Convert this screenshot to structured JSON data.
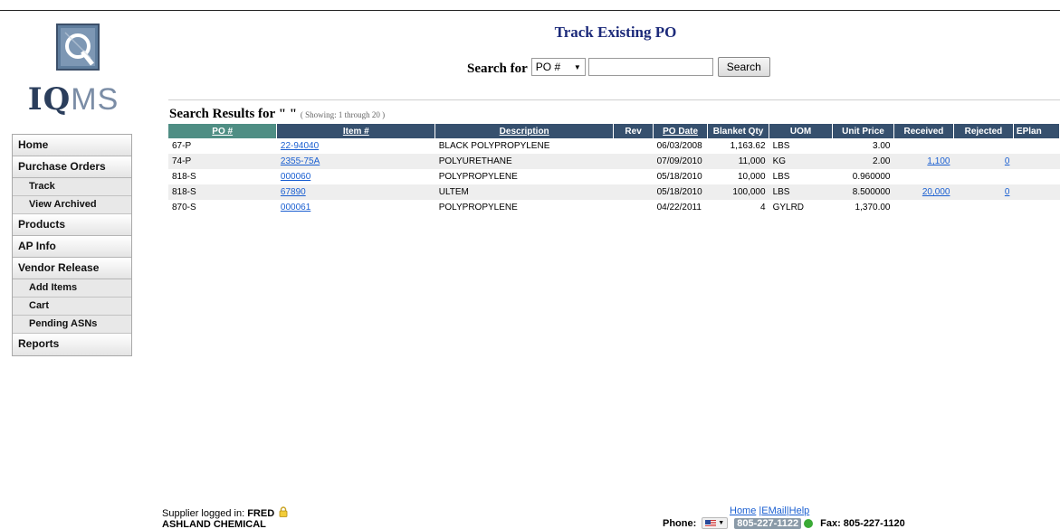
{
  "brand": {
    "logo_text_a": "IQ",
    "logo_text_b": "MS"
  },
  "page": {
    "title": "Track Existing PO"
  },
  "search": {
    "label": "Search for",
    "field_option": "PO #",
    "query_value": "",
    "button_label": "Search"
  },
  "sidebar": {
    "home": "Home",
    "purchase_orders": "Purchase Orders",
    "track": "Track",
    "view_archived": "View Archived",
    "products": "Products",
    "ap_info": "AP Info",
    "vendor_release": "Vendor Release",
    "add_items": "Add Items",
    "cart": "Cart",
    "pending_asns": "Pending ASNs",
    "reports": "Reports"
  },
  "results": {
    "heading": "Search Results for \" \"",
    "showing": "( Showing: 1 through 20 )",
    "columns": [
      "PO #",
      "Item #",
      "Description",
      "Rev",
      "PO Date",
      "Blanket Qty",
      "UOM",
      "Unit Price",
      "Received",
      "Rejected",
      "EPlan"
    ],
    "rows": [
      {
        "po": "67-P",
        "item": "22-94040",
        "desc": "BLACK POLYPROPYLENE",
        "rev": "",
        "date": "06/03/2008",
        "qty": "1,163.62",
        "uom": "LBS",
        "price": "3.00",
        "received": "",
        "rejected": ""
      },
      {
        "po": "74-P",
        "item": "2355-75A",
        "desc": "POLYURETHANE",
        "rev": "",
        "date": "07/09/2010",
        "qty": "11,000",
        "uom": "KG",
        "price": "2.00",
        "received": "1,100",
        "rejected": "0"
      },
      {
        "po": "818-S",
        "item": "000060",
        "desc": "POLYPROPYLENE",
        "rev": "",
        "date": "05/18/2010",
        "qty": "10,000",
        "uom": "LBS",
        "price": "0.960000",
        "received": "",
        "rejected": ""
      },
      {
        "po": "818-S",
        "item": "67890",
        "desc": "ULTEM",
        "rev": "",
        "date": "05/18/2010",
        "qty": "100,000",
        "uom": "LBS",
        "price": "8.500000",
        "received": "20,000",
        "rejected": "0"
      },
      {
        "po": "870-S",
        "item": "000061",
        "desc": "POLYPROPYLENE",
        "rev": "",
        "date": "04/22/2011",
        "qty": "4",
        "uom": "GYLRD",
        "price": "1,370.00",
        "received": "",
        "rejected": ""
      }
    ]
  },
  "footer": {
    "logged_in_label": "Supplier logged in:",
    "user": "FRED",
    "company": "ASHLAND CHEMICAL",
    "link_home": "Home",
    "link_email": "EMail",
    "link_help": "Help",
    "sep": "|",
    "phone_label": "Phone:",
    "phone": "805-227-1122",
    "fax": "Fax: 805-227-1120"
  },
  "colors": {
    "header_bg": "#36506e",
    "sort_col_bg": "#4f8e84",
    "link": "#1a5fd1",
    "title": "#1c2a7a"
  }
}
